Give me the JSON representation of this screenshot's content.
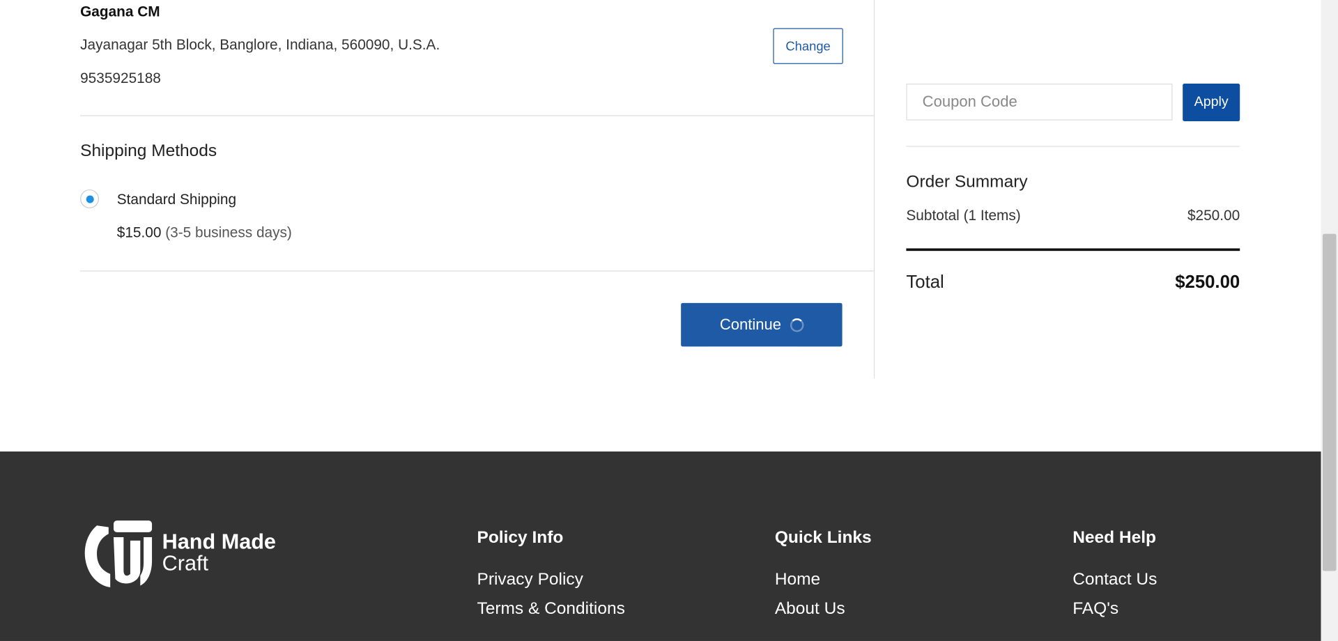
{
  "address": {
    "name": "Gagana CM",
    "line": "Jayanagar 5th Block,  Banglore,  Indiana,  560090, U.S.A.",
    "phone": "9535925188",
    "change_label": "Change"
  },
  "shipping": {
    "title": "Shipping Methods",
    "method_name": "Standard Shipping",
    "price": "$15.00",
    "days": " (3-5 business days)",
    "selected": true
  },
  "continue_label": "Continue",
  "coupon": {
    "placeholder": "Coupon Code",
    "apply_label": "Apply"
  },
  "summary": {
    "title": "Order Summary",
    "subtotal_label": "Subtotal (1 Items)",
    "subtotal_value": "$250.00",
    "total_label": "Total",
    "total_value": "$250.00"
  },
  "footer": {
    "logo_line1": "Hand Made",
    "logo_line2": "Craft",
    "columns": [
      {
        "heading": "Policy Info",
        "links": [
          "Privacy Policy",
          "Terms & Conditions"
        ]
      },
      {
        "heading": "Quick Links",
        "links": [
          "Home",
          "About Us"
        ]
      },
      {
        "heading": "Need Help",
        "links": [
          "Contact Us",
          "FAQ's"
        ]
      }
    ]
  },
  "colors": {
    "primary": "#1f5aa6",
    "footer_bg": "#333333",
    "radio": "#1a8fe3"
  }
}
